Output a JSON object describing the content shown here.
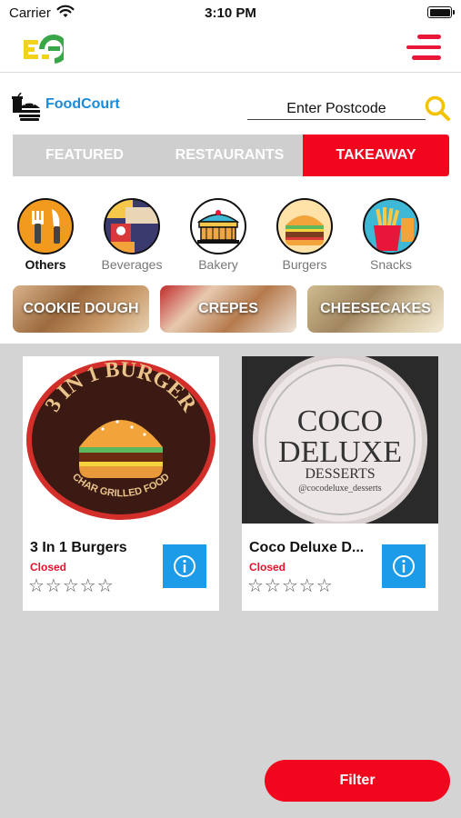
{
  "status_bar": {
    "carrier": "Carrier",
    "time": "3:10 PM"
  },
  "header": {
    "logo_icon": "app-logo-icon",
    "menu_icon": "hamburger-menu-icon",
    "accent": "#e8173a"
  },
  "brand": {
    "name": "FoodCourt",
    "icon": "burger-drink-icon",
    "color": "#1b8ad8"
  },
  "search": {
    "placeholder": "Enter Postcode",
    "icon": "search-icon"
  },
  "tabs": [
    {
      "label": "FEATURED",
      "active": false
    },
    {
      "label": "RESTAURANTS",
      "active": false
    },
    {
      "label": "TAKEAWAY",
      "active": true
    }
  ],
  "categories": [
    {
      "label": "Others",
      "icon": "cutlery-icon",
      "active": true
    },
    {
      "label": "Beverages",
      "icon": "beverage-icon",
      "active": false
    },
    {
      "label": "Bakery",
      "icon": "bakery-icon",
      "active": false
    },
    {
      "label": "Burgers",
      "icon": "burger-icon",
      "active": false
    },
    {
      "label": "Snacks",
      "icon": "fries-icon",
      "active": false
    }
  ],
  "promos": [
    {
      "label": "COOKIE DOUGH"
    },
    {
      "label": "CREPES"
    },
    {
      "label": "CHEESECAKES"
    }
  ],
  "restaurants": [
    {
      "name": "3 In 1 Burgers",
      "status": "Closed",
      "rating": 0,
      "stars": "☆☆☆☆☆",
      "logo": {
        "line1": "3 IN 1 BURGER",
        "line2": "CHAR GRILLED FOOD"
      }
    },
    {
      "name": "Coco Deluxe D...",
      "status": "Closed",
      "rating": 0,
      "stars": "☆☆☆☆☆",
      "logo": {
        "line1": "COCO",
        "line2": "DELUXE",
        "line3": "DESSERTS",
        "line4": "@cocodeluxe_desserts"
      }
    }
  ],
  "filter": {
    "label": "Filter"
  },
  "colors": {
    "primary_red": "#f2061d",
    "info_blue": "#1b9be8",
    "list_bg": "#d4d4d4"
  }
}
